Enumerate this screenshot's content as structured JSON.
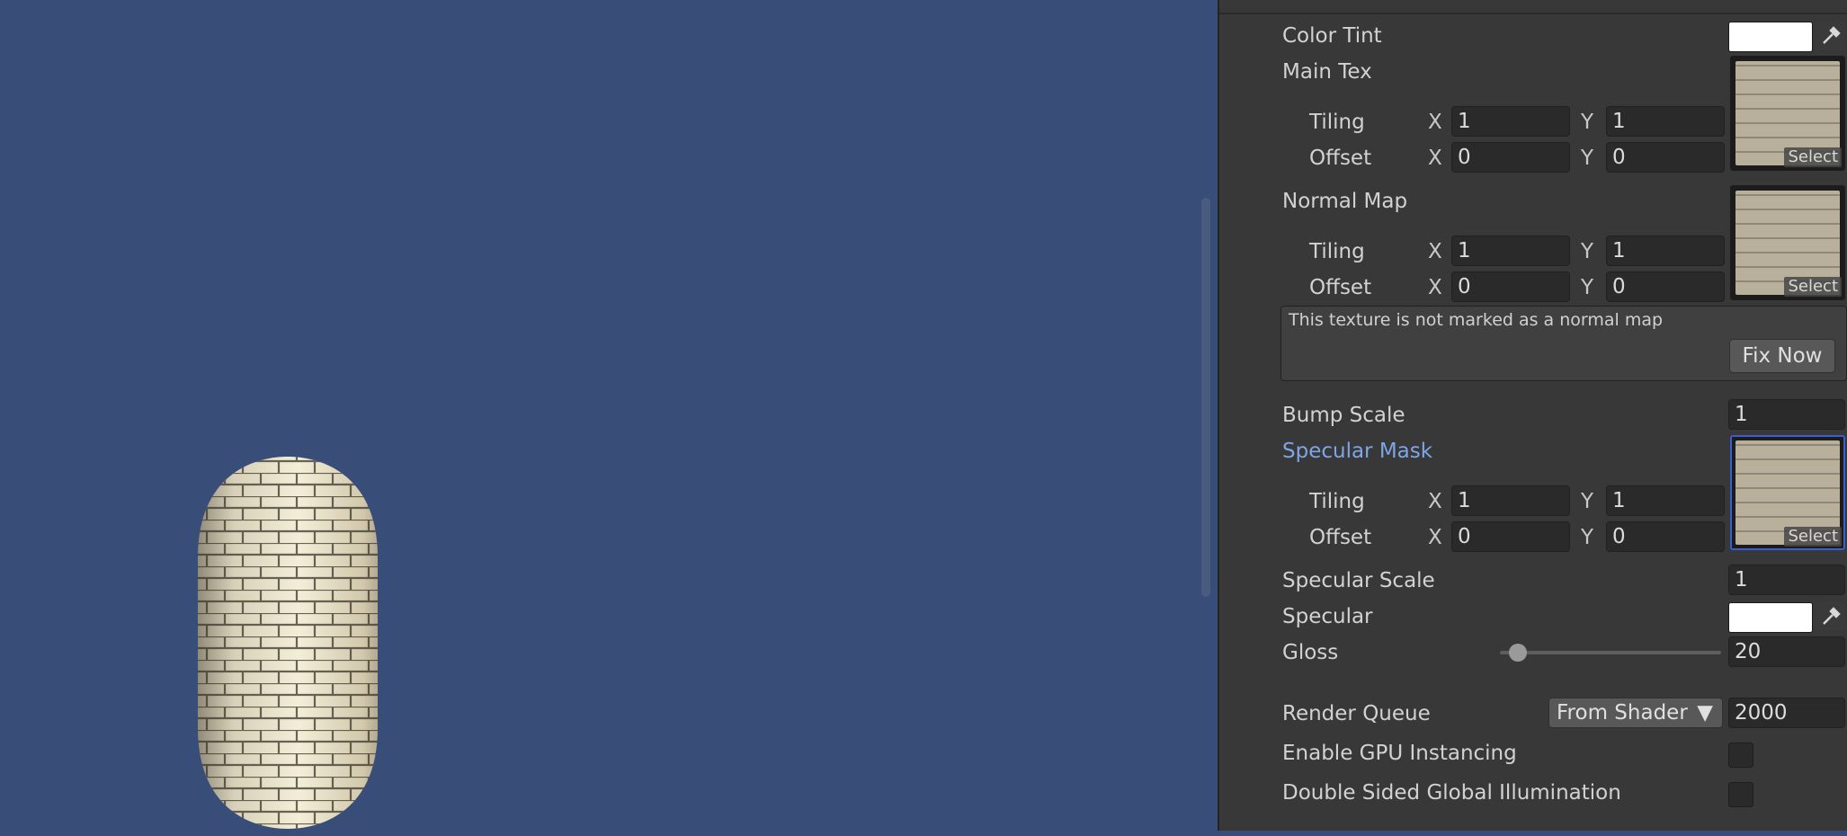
{
  "inspector": {
    "color_tint": {
      "label": "Color Tint",
      "color": "#ffffff"
    },
    "main_tex": {
      "label": "Main Tex",
      "tiling_label": "Tiling",
      "offset_label": "Offset",
      "tiling_x": "1",
      "tiling_y": "1",
      "offset_x": "0",
      "offset_y": "0",
      "select_label": "Select"
    },
    "normal_map": {
      "label": "Normal Map",
      "tiling_label": "Tiling",
      "offset_label": "Offset",
      "tiling_x": "1",
      "tiling_y": "1",
      "offset_x": "0",
      "offset_y": "0",
      "select_label": "Select"
    },
    "warning": {
      "message": "This texture is not marked as a normal map",
      "fix_label": "Fix Now"
    },
    "bump_scale": {
      "label": "Bump Scale",
      "value": "1"
    },
    "specular_mask": {
      "label": "Specular Mask",
      "tiling_label": "Tiling",
      "offset_label": "Offset",
      "tiling_x": "1",
      "tiling_y": "1",
      "offset_x": "0",
      "offset_y": "0",
      "select_label": "Select"
    },
    "specular_scale": {
      "label": "Specular Scale",
      "value": "1"
    },
    "specular": {
      "label": "Specular",
      "color": "#ffffff"
    },
    "gloss": {
      "label": "Gloss",
      "value": "20",
      "slider_fraction": 0.08
    },
    "render_queue": {
      "label": "Render Queue",
      "dropdown": "From Shader",
      "value": "2000"
    },
    "gpu_instancing": {
      "label": "Enable GPU Instancing",
      "checked": false
    },
    "double_sided_gi": {
      "label": "Double Sided Global Illumination",
      "checked": false
    },
    "axis_x": "X",
    "axis_y": "Y"
  },
  "colors": {
    "scene_background": "#384d78",
    "panel_background": "#383838",
    "accent": "#7ea6e6"
  }
}
